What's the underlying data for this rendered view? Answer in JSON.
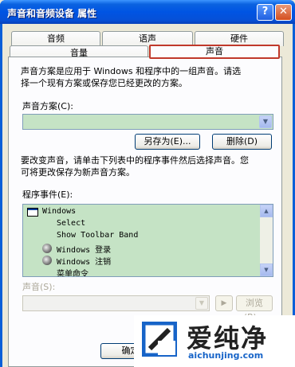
{
  "window": {
    "title": "声音和音频设备 属性",
    "help_label": "?",
    "close_label": "✕"
  },
  "tabs": {
    "row1": [
      "音频",
      "语声",
      "硬件"
    ],
    "row2": [
      "音量",
      "声音"
    ],
    "active": "声音"
  },
  "content": {
    "description_line1": "声音方案是应用于 Windows 和程序中的一组声音。请选",
    "description_line2": "择一个现有方案或保存您已经更改的方案。",
    "scheme_label": "声音方案(C):",
    "scheme_value": "",
    "save_as_button": "另存为(E)...",
    "delete_button": "删除(D)",
    "instruction_line1": "要改变声音，请单击下列表中的程序事件然后选择声音。您",
    "instruction_line2": "可将更改保存为新声音方案。",
    "events_label": "程序事件(E):",
    "events": [
      {
        "label": "Windows",
        "icon": "window-icon"
      },
      {
        "label": "Select",
        "icon": ""
      },
      {
        "label": "Show Toolbar Band",
        "icon": ""
      },
      {
        "label": "Windows 登录",
        "icon": "speaker-icon"
      },
      {
        "label": "Windows 注销",
        "icon": "speaker-icon"
      },
      {
        "label": "菜单命令",
        "icon": ""
      }
    ],
    "sound_label": "声音(S):",
    "sound_value": "",
    "play_button": "▶",
    "browse_button": "浏览(B)...",
    "ok_button": "确定"
  },
  "watermark": {
    "brand_cn": "爱纯净",
    "brand_en": "aichunjing.com"
  },
  "colors": {
    "title_blue": "#0054e3",
    "list_bg": "#c5e3c5",
    "dialog_bg": "#ece9d8",
    "active_tab_border": "#c0392b"
  }
}
